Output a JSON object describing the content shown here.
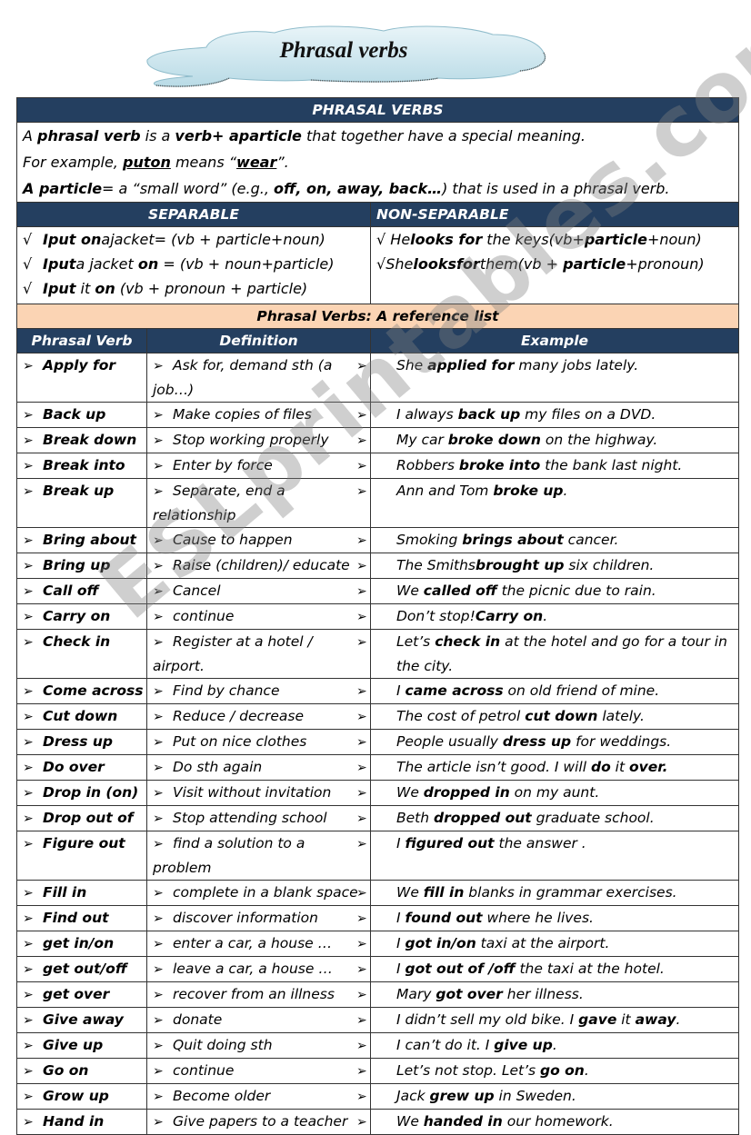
{
  "page": {
    "title": "Phrasal verbs",
    "watermark": "ESLprintables.com",
    "colors": {
      "header_dark": "#243f60",
      "header_peach": "#fbd4b4",
      "cloud_fill": "#cfe7ef"
    }
  },
  "intro": {
    "header": "PHRASAL VERBS",
    "line1": {
      "a": "A ",
      "b1": "phrasal verb",
      "c": " is a ",
      "b2": "verb+ aparticle",
      "d": " that together have a special meaning."
    },
    "line2": {
      "a": "For example, ",
      "u1": "puton",
      "c": " means “",
      "u2": "wear",
      "d": "”."
    },
    "line3": {
      "b1": "A particle",
      "a": "= a “small word” (e.g., ",
      "b2": "off, on, away, back…",
      "c": ") that is used in a phrasal verb."
    }
  },
  "types": {
    "separable_header": "SEPARABLE",
    "non_separable_header": "NON-SEPARABLE",
    "check_symbol": "√",
    "separable": [
      {
        "b1": "Iput on",
        "t1": "ajacket= (vb + particle+noun)",
        "b2": "",
        "t2": ""
      },
      {
        "b1": "Iput",
        "t1": "a jacket ",
        "b2": "on",
        "t2": " = (vb + noun+particle)"
      },
      {
        "b1": "Iput",
        "t1": " it ",
        "b2": "on",
        "t2": " (vb + pronoun + particle)"
      }
    ],
    "non_separable": [
      {
        "t0": " He",
        "b1": "looks  for",
        "t1": " the keys(vb+",
        "b2": "particle",
        "t2": "+noun)"
      },
      {
        "t0": "She",
        "b1": "looksfor",
        "t1": "them(vb + ",
        "b2": "particle",
        "t2": "+pronoun)"
      }
    ]
  },
  "reference": {
    "title": "Phrasal Verbs: A reference list",
    "columns": [
      "Phrasal Verb",
      "Definition",
      "Example"
    ],
    "arrow_symbol": "➢",
    "rows": [
      {
        "verb": "Apply for",
        "definition": "Ask for, demand sth (a job…)",
        "example": [
          [
            "She ",
            false
          ],
          [
            "applied for",
            true
          ],
          [
            " many jobs lately.",
            false
          ]
        ]
      },
      {
        "verb": "Back up",
        "definition": "Make copies of files",
        "example": [
          [
            "I always ",
            false
          ],
          [
            "back up",
            true
          ],
          [
            " my files on a DVD.",
            false
          ]
        ]
      },
      {
        "verb": "Break down",
        "definition": "Stop working properly",
        "example": [
          [
            "My car ",
            false
          ],
          [
            "broke down",
            true
          ],
          [
            " on the highway.",
            false
          ]
        ]
      },
      {
        "verb": "Break into",
        "definition": "Enter by force",
        "example": [
          [
            "Robbers ",
            false
          ],
          [
            "broke into",
            true
          ],
          [
            " the bank last night.",
            false
          ]
        ]
      },
      {
        "verb": "Break up",
        "definition": "Separate, end a relationship",
        "example": [
          [
            "Ann and Tom ",
            false
          ],
          [
            "broke up",
            true
          ],
          [
            ".",
            false
          ]
        ]
      },
      {
        "verb": "Bring about",
        "definition": "Cause to happen",
        "example": [
          [
            "Smoking ",
            false
          ],
          [
            "brings about",
            true
          ],
          [
            " cancer.",
            false
          ]
        ]
      },
      {
        "verb": "Bring up",
        "definition": "Raise (children)/ educate",
        "example": [
          [
            "The Smiths",
            false
          ],
          [
            "brought up",
            true
          ],
          [
            " six children.",
            false
          ]
        ]
      },
      {
        "verb": "Call off",
        "definition": "Cancel",
        "example": [
          [
            "We ",
            false
          ],
          [
            "called off",
            true
          ],
          [
            " the picnic due to rain.",
            false
          ]
        ]
      },
      {
        "verb": "Carry on",
        "definition": "continue",
        "example": [
          [
            "Don’t stop!",
            false
          ],
          [
            "Carry on",
            true
          ],
          [
            ".",
            false
          ]
        ]
      },
      {
        "verb": "Check in",
        "definition": "Register at a hotel / airport.",
        "example": [
          [
            "Let’s ",
            false
          ],
          [
            "check in",
            true
          ],
          [
            " at the hotel and go for a tour in the city.",
            false
          ]
        ],
        "tall": true
      },
      {
        "verb": "Come across",
        "definition": "Find by chance",
        "example": [
          [
            "I ",
            false
          ],
          [
            "came across",
            true
          ],
          [
            " on old friend of mine.",
            false
          ]
        ]
      },
      {
        "verb": "Cut down",
        "definition": "Reduce / decrease",
        "example": [
          [
            "The cost of petrol ",
            false
          ],
          [
            "cut down",
            true
          ],
          [
            " lately.",
            false
          ]
        ]
      },
      {
        "verb": "Dress up",
        "definition": "Put on nice clothes",
        "example": [
          [
            "People usually ",
            false
          ],
          [
            "dress up",
            true
          ],
          [
            " for weddings.",
            false
          ]
        ]
      },
      {
        "verb": "Do over",
        "definition": "Do sth again",
        "example": [
          [
            "The article isn’t good. I will ",
            false
          ],
          [
            "do",
            true
          ],
          [
            " it ",
            false
          ],
          [
            "over.",
            true
          ]
        ]
      },
      {
        "verb": "Drop in (on)",
        "definition": "Visit without invitation",
        "example": [
          [
            "We ",
            false
          ],
          [
            "dropped in",
            true
          ],
          [
            " on my aunt.",
            false
          ]
        ]
      },
      {
        "verb": "Drop out of",
        "definition": "Stop attending school",
        "example": [
          [
            "Beth ",
            false
          ],
          [
            "dropped out",
            true
          ],
          [
            " graduate school.",
            false
          ]
        ]
      },
      {
        "verb": "Figure out",
        "definition": "find a solution to a problem",
        "example": [
          [
            "I ",
            false
          ],
          [
            "figured out",
            true
          ],
          [
            " the answer .",
            false
          ]
        ]
      },
      {
        "verb": "Fill in",
        "definition": "complete in a blank space",
        "example": [
          [
            "We ",
            false
          ],
          [
            "fill in",
            true
          ],
          [
            " blanks in grammar exercises.",
            false
          ]
        ]
      },
      {
        "verb": "Find out",
        "definition": "discover information",
        "example": [
          [
            "I ",
            false
          ],
          [
            "found out",
            true
          ],
          [
            " where he lives.",
            false
          ]
        ]
      },
      {
        "verb": "get in/on",
        "definition": "enter a car, a house …",
        "example": [
          [
            "I ",
            false
          ],
          [
            "got in/on",
            true
          ],
          [
            " taxi at the airport.",
            false
          ]
        ]
      },
      {
        "verb": "get out/off",
        "definition": "leave a car, a house …",
        "example": [
          [
            "I ",
            false
          ],
          [
            "got out of /off",
            true
          ],
          [
            " the taxi at the hotel.",
            false
          ]
        ]
      },
      {
        "verb": "get over",
        "definition": "recover from an illness",
        "example": [
          [
            "Mary ",
            false
          ],
          [
            "got over",
            true
          ],
          [
            " her illness.",
            false
          ]
        ]
      },
      {
        "verb": "Give away",
        "definition": "donate",
        "example": [
          [
            "I didn’t sell my old bike. I ",
            false
          ],
          [
            "gave",
            true
          ],
          [
            " it ",
            false
          ],
          [
            "away",
            true
          ],
          [
            ".",
            false
          ]
        ]
      },
      {
        "verb": "Give up",
        "definition": "Quit doing sth",
        "example": [
          [
            "I can’t do it. I ",
            false
          ],
          [
            "give up",
            true
          ],
          [
            ".",
            false
          ]
        ]
      },
      {
        "verb": "Go on",
        "definition": "continue",
        "example": [
          [
            "Let’s not stop. Let’s ",
            false
          ],
          [
            "go on",
            true
          ],
          [
            ".",
            false
          ]
        ]
      },
      {
        "verb": "Grow up",
        "definition": "Become older",
        "example": [
          [
            "Jack ",
            false
          ],
          [
            "grew up",
            true
          ],
          [
            " in Sweden.",
            false
          ]
        ]
      },
      {
        "verb": "Hand in",
        "definition": "Give papers to a teacher",
        "example": [
          [
            "We ",
            false
          ],
          [
            "handed in",
            true
          ],
          [
            " our homework.",
            false
          ]
        ]
      }
    ]
  }
}
